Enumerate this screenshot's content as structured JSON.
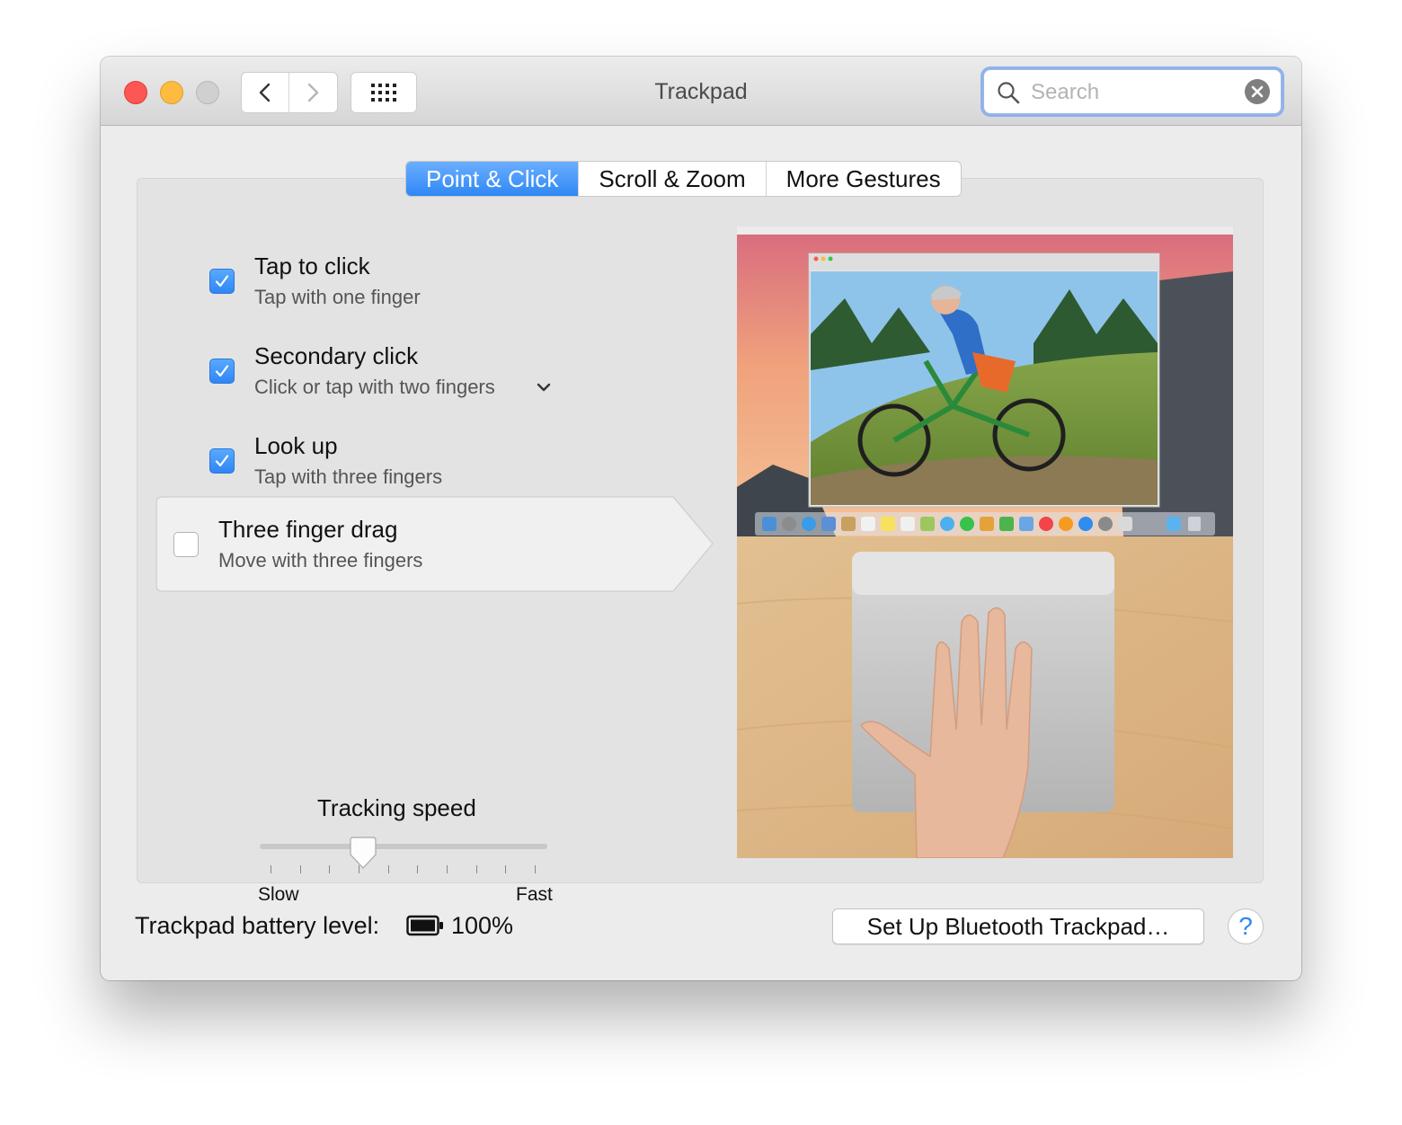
{
  "window": {
    "title": "Trackpad",
    "search": {
      "placeholder": "Search",
      "value": ""
    }
  },
  "icons": {
    "close": "close-button",
    "minimize": "minimize-button",
    "zoom": "zoom-button",
    "back": "chevron-left-icon",
    "forward": "chevron-right-icon",
    "show_all": "grid-icon",
    "search": "magnifier-icon",
    "clear": "clear-icon",
    "checkbox": "checkmark-icon",
    "dropdown": "chevron-down-icon",
    "battery": "battery-icon",
    "help": "question-icon"
  },
  "tabs": [
    {
      "label": "Point & Click",
      "active": true
    },
    {
      "label": "Scroll & Zoom",
      "active": false
    },
    {
      "label": "More Gestures",
      "active": false
    }
  ],
  "options": [
    {
      "title": "Tap to click",
      "subtitle": "Tap with one finger",
      "checked": true
    },
    {
      "title": "Secondary click",
      "subtitle": "Click or tap with two fingers",
      "checked": true
    },
    {
      "title": "Look up",
      "subtitle": "Tap with three fingers",
      "checked": true
    },
    {
      "title": "Three finger drag",
      "subtitle": "Move with three fingers",
      "checked": false
    }
  ],
  "tracking": {
    "label": "Tracking speed",
    "min_label": "Slow",
    "max_label": "Fast",
    "value": 0.35,
    "tick_count": 10
  },
  "footer": {
    "battery_label": "Trackpad battery level:",
    "battery_value": "100%",
    "setup_button": "Set Up Bluetooth Trackpad…",
    "help_button": "?"
  },
  "colors": {
    "accent": "#2f86f4",
    "close": "#fc5753",
    "minimize": "#fdbc40",
    "zoom": "#d0d0d0"
  }
}
